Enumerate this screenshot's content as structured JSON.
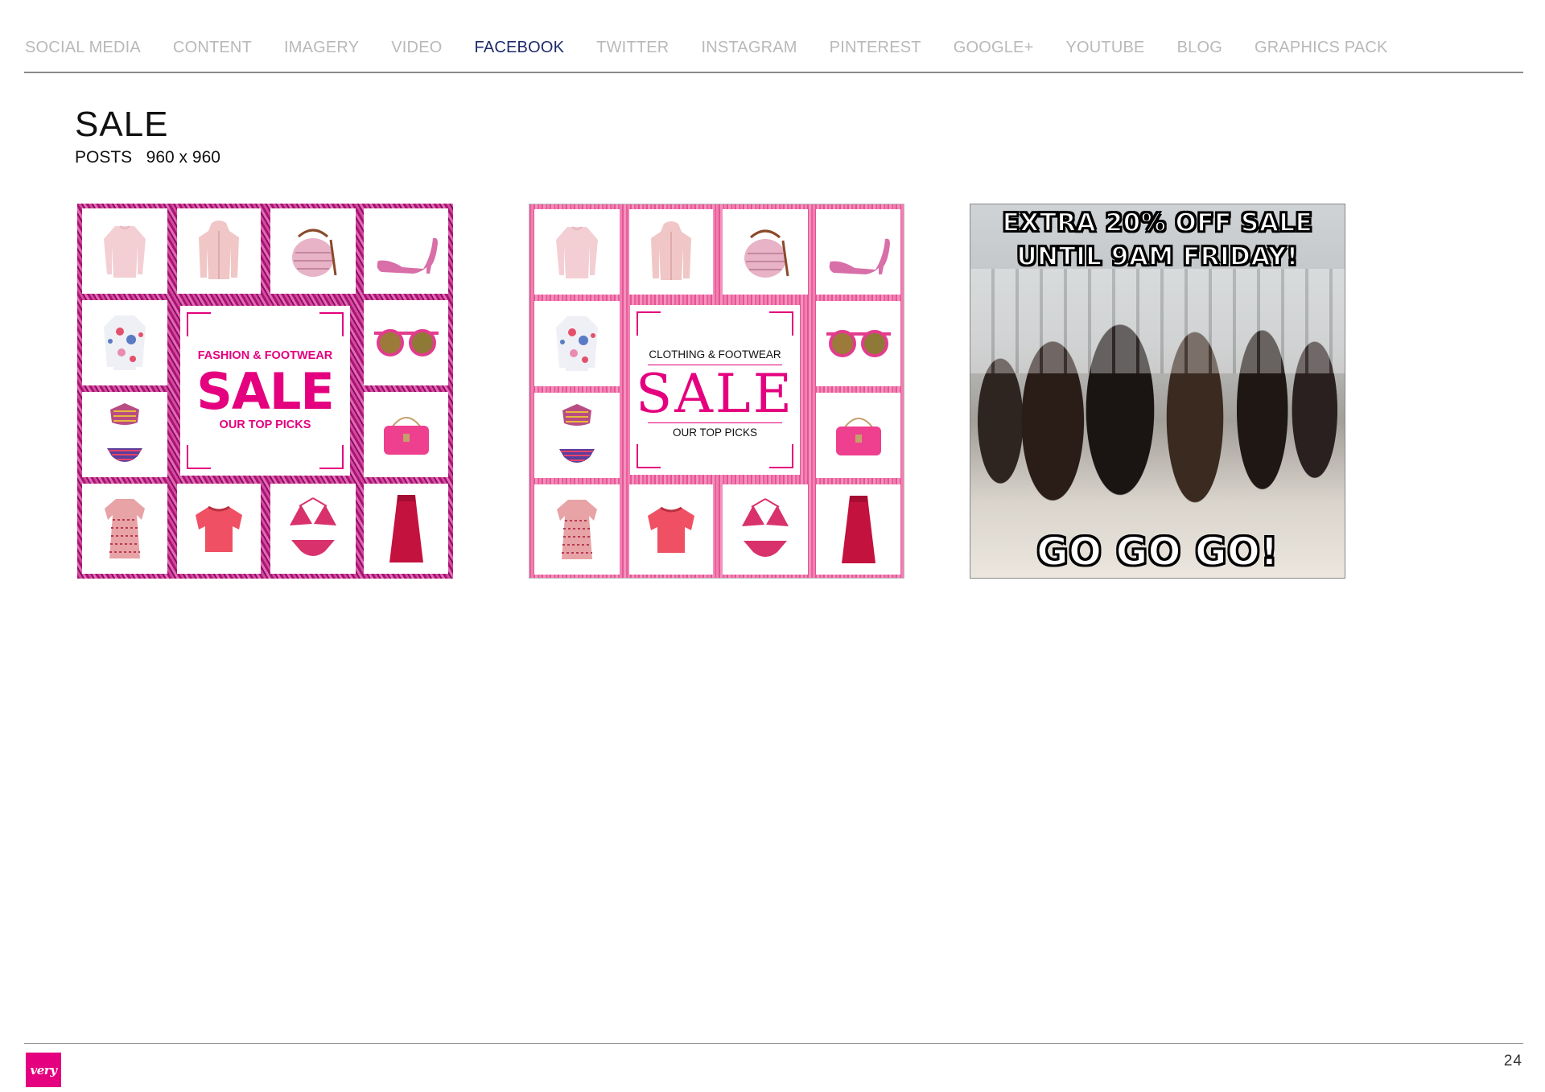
{
  "nav": {
    "items": [
      {
        "label": "SOCIAL MEDIA",
        "active": false
      },
      {
        "label": "CONTENT",
        "active": false
      },
      {
        "label": "IMAGERY",
        "active": false
      },
      {
        "label": "VIDEO",
        "active": false
      },
      {
        "label": "FACEBOOK",
        "active": true
      },
      {
        "label": "TWITTER",
        "active": false
      },
      {
        "label": "INSTAGRAM",
        "active": false
      },
      {
        "label": "PINTEREST",
        "active": false
      },
      {
        "label": "GOOGLE+",
        "active": false
      },
      {
        "label": "YOUTUBE",
        "active": false
      },
      {
        "label": "BLOG",
        "active": false
      },
      {
        "label": "GRAPHICS PACK",
        "active": false
      }
    ]
  },
  "section": {
    "title": "SALE",
    "subtitle": "POSTS   960 x 960"
  },
  "posts": {
    "post1": {
      "line1": "FASHION & FOOTWEAR",
      "headline": "SALE",
      "line3": "OUR TOP PICKS"
    },
    "post2": {
      "line1": "CLOTHING & FOOTWEAR",
      "headline": "SALE",
      "line3": "OUR TOP PICKS"
    },
    "post3": {
      "top_caption": "EXTRA 20% OFF SALE UNTIL 9AM FRIDAY!",
      "bottom_caption": "GO GO GO!"
    },
    "products": [
      "jumper-icon",
      "hooded-jacket-icon",
      "knit-bag-icon",
      "high-heel-icon",
      "floral-shirt-icon",
      "sunglasses-icon",
      "bikini-icon",
      "handbag-icon",
      "printed-dress-icon",
      "pink-top-icon",
      "triangle-bikini-icon",
      "maxi-dress-icon"
    ]
  },
  "footer": {
    "logo_text": "very",
    "page_number": "24"
  },
  "colors": {
    "accent": "#e4007e",
    "nav_active": "#1e2b6b",
    "nav_inactive": "#b9b9b9"
  }
}
